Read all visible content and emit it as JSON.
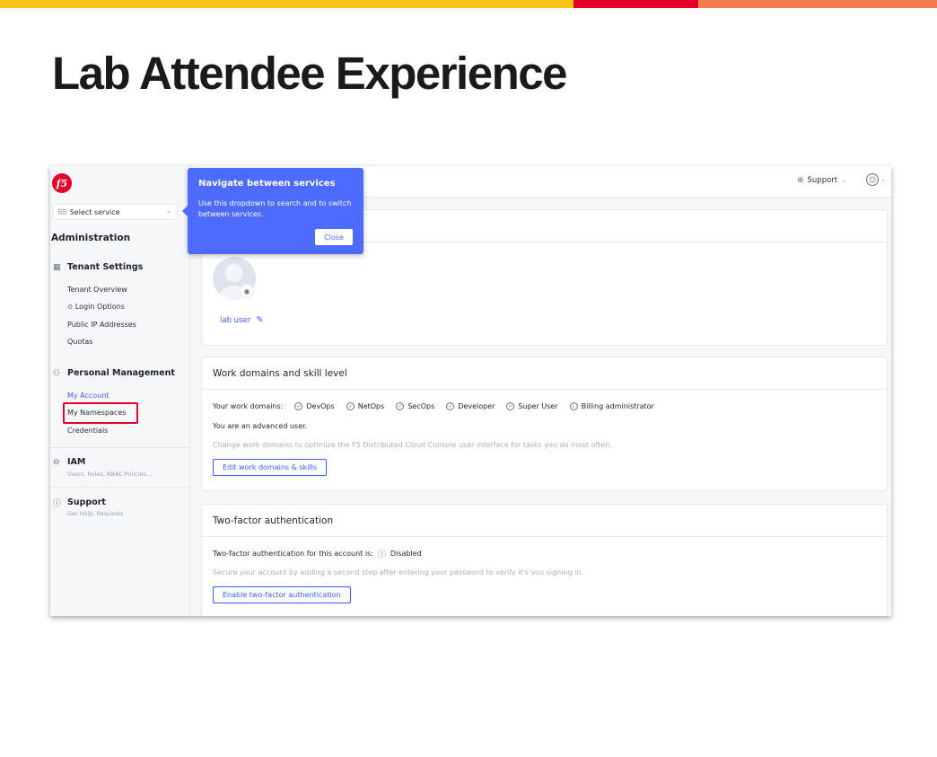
{
  "slide": {
    "title": "Lab Attendee Experience"
  },
  "colors": {
    "accent_yellow": "#f5c518",
    "accent_red": "#e4002b",
    "accent_orange": "#f47b4f",
    "primary_blue": "#3d5afe",
    "tooltip_blue": "#4e6bff"
  },
  "app": {
    "logo_text": "f5",
    "select_service": {
      "label": "Select service",
      "icon": "grid-icon"
    },
    "admin_title": "Administration",
    "sidebar": {
      "tenant_settings": {
        "label": "Tenant Settings",
        "icon": "building-icon",
        "items": [
          "Tenant Overview",
          "Login Options",
          "Public IP Addresses",
          "Quotas"
        ]
      },
      "personal_management": {
        "label": "Personal Management",
        "icon": "person-icon",
        "items": [
          "My Account",
          "My Namespaces",
          "Credentials"
        ]
      },
      "iam": {
        "label": "IAM",
        "subtitle": "Users, Roles, RBAC Policies,...",
        "icon": "key-icon"
      },
      "support": {
        "label": "Support",
        "subtitle": "Get Help, Requests",
        "icon": "question-icon"
      }
    },
    "header": {
      "support_label": "Support"
    },
    "tooltip": {
      "title": "Navigate between services",
      "body": "Use this dropdown to search and to switch between services.",
      "close_label": "Close"
    },
    "profile": {
      "user_name": "lab user"
    },
    "domains_card": {
      "title": "Work domains and skill level",
      "domains_label": "Your work domains:",
      "domains": [
        "DevOps",
        "NetOps",
        "SecOps",
        "Developer",
        "Super User",
        "Billing administrator"
      ],
      "level_text": "You are an advanced user.",
      "hint": "Change work domains to optimize the F5 Distributed Cloud Console user interface for tasks you do most often.",
      "button": "Edit work domains & skills"
    },
    "twofa_card": {
      "title": "Two-factor authentication",
      "status_label": "Two-factor authentication for this account is:",
      "status_value": "Disabled",
      "hint": "Secure your account by adding a second step after entering your password to verify it's you signing in.",
      "button": "Enable two-factor authentication"
    }
  }
}
